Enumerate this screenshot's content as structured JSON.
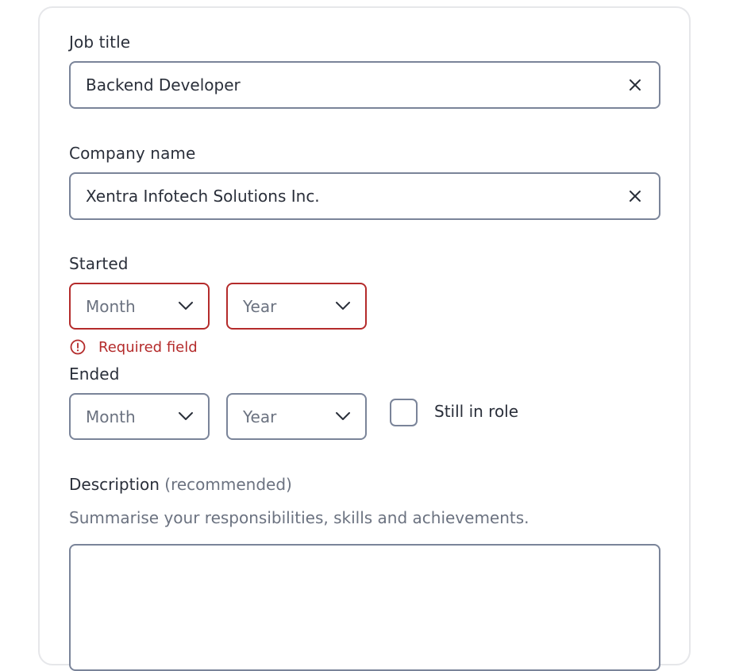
{
  "form": {
    "job_title": {
      "label": "Job title",
      "value": "Backend Developer",
      "clear_icon": "close-icon"
    },
    "company_name": {
      "label": "Company name",
      "value": "Xentra Infotech Solutions Inc.",
      "clear_icon": "close-icon"
    },
    "started": {
      "label": "Started",
      "month_placeholder": "Month",
      "year_placeholder": "Year",
      "error": "Required field",
      "error_icon": "alert-circle-icon"
    },
    "ended": {
      "label": "Ended",
      "month_placeholder": "Month",
      "year_placeholder": "Year",
      "still_in_role_label": "Still in role",
      "still_in_role_checked": false
    },
    "description": {
      "label": "Description",
      "label_suffix": "(recommended)",
      "helper": "Summarise your responsibilities, skills and achievements.",
      "value": ""
    }
  },
  "colors": {
    "border": "#7a8499",
    "error": "#b42b2b",
    "text": "#2a2f3a",
    "muted": "#6b7280",
    "card_border": "#e6e7ea"
  }
}
